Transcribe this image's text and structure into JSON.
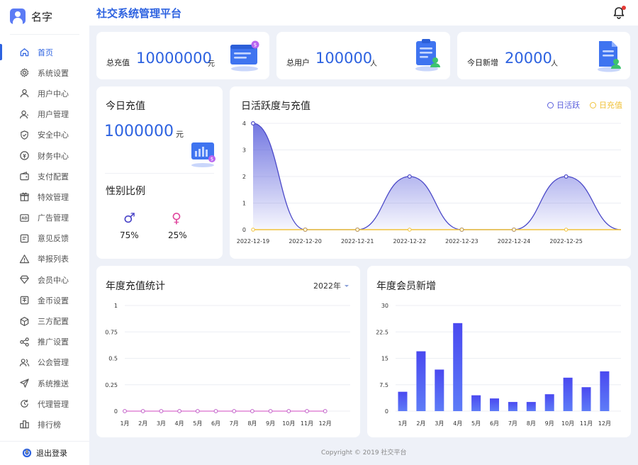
{
  "app": {
    "title": "社交系统管理平台",
    "user_name": "名字"
  },
  "sidebar": {
    "items": [
      {
        "label": "首页",
        "icon": "home-icon",
        "active": true
      },
      {
        "label": "系统设置",
        "icon": "gear-icon"
      },
      {
        "label": "用户中心",
        "icon": "user-icon"
      },
      {
        "label": "用户管理",
        "icon": "user-manage-icon"
      },
      {
        "label": "安全中心",
        "icon": "shield-icon"
      },
      {
        "label": "财务中心",
        "icon": "finance-icon"
      },
      {
        "label": "支付配置",
        "icon": "wallet-icon"
      },
      {
        "label": "特效管理",
        "icon": "gift-icon"
      },
      {
        "label": "广告管理",
        "icon": "ad-icon"
      },
      {
        "label": "意见反馈",
        "icon": "feedback-icon"
      },
      {
        "label": "举报列表",
        "icon": "warning-icon"
      },
      {
        "label": "会员中心",
        "icon": "diamond-icon"
      },
      {
        "label": "金币设置",
        "icon": "coin-icon"
      },
      {
        "label": "三方配置",
        "icon": "cube-icon"
      },
      {
        "label": "推广设置",
        "icon": "share-icon"
      },
      {
        "label": "公会管理",
        "icon": "group-icon"
      },
      {
        "label": "系统推送",
        "icon": "send-icon"
      },
      {
        "label": "代理管理",
        "icon": "proxy-icon"
      },
      {
        "label": "排行榜",
        "icon": "ranking-icon"
      }
    ],
    "logout_label": "退出登录"
  },
  "stats": [
    {
      "label": "总充值",
      "value": "10000000",
      "unit": "元"
    },
    {
      "label": "总用户",
      "value": "100000",
      "unit": "人"
    },
    {
      "label": "今日新增",
      "value": "20000",
      "unit": "人"
    }
  ],
  "today": {
    "title": "今日充值",
    "value": "1000000",
    "unit": "元",
    "gender_title": "性别比例",
    "male_pct": "75%",
    "female_pct": "25%",
    "male_symbol": "♂",
    "female_symbol": "♀"
  },
  "year_select": "2022年",
  "footer": {
    "copyright": "Copyright © 2019 社交平台"
  },
  "colors": {
    "accent": "#2d62e0",
    "active_series": "#5a5fdc",
    "recharge_series": "#f0c239",
    "male": "#4a44c8",
    "female": "#e0479e"
  },
  "chart_data": [
    {
      "id": "daily",
      "type": "area",
      "title": "日活跃度与充值",
      "x": [
        "2022-12-19",
        "2022-12-20",
        "2022-12-21",
        "2022-12-22",
        "2022-12-23",
        "2022-12-24",
        "2022-12-25"
      ],
      "series": [
        {
          "name": "日活跃",
          "values": [
            4,
            0,
            0,
            2,
            0,
            0,
            2
          ]
        },
        {
          "name": "日充值",
          "values": [
            0,
            0,
            0,
            0,
            0,
            0,
            0
          ]
        }
      ],
      "yticks": [
        "0",
        "1",
        "2",
        "3",
        "4"
      ],
      "ylim": [
        0,
        4
      ],
      "legend": "top-right"
    },
    {
      "id": "annual_recharge",
      "type": "line",
      "title": "年度充值统计",
      "categories": [
        "1月",
        "2月",
        "3月",
        "4月",
        "5月",
        "6月",
        "7月",
        "8月",
        "9月",
        "10月",
        "11月",
        "12月"
      ],
      "values": [
        0,
        0,
        0,
        0,
        0,
        0,
        0,
        0,
        0,
        0,
        0,
        0
      ],
      "yticks": [
        "0",
        "0.25",
        "0.5",
        "0.75",
        "1"
      ],
      "ylim": [
        0,
        1
      ]
    },
    {
      "id": "annual_members",
      "type": "bar",
      "title": "年度会员新增",
      "categories": [
        "1月",
        "2月",
        "3月",
        "4月",
        "5月",
        "6月",
        "7月",
        "8月",
        "9月",
        "10月",
        "11月",
        "12月"
      ],
      "values": [
        5.5,
        17,
        11.8,
        25,
        4.5,
        3.6,
        2.6,
        2.6,
        4.8,
        9.5,
        6.8,
        11.3
      ],
      "yticks": [
        "0",
        "7.5",
        "15",
        "22.5",
        "30"
      ],
      "ylim": [
        0,
        30
      ]
    }
  ]
}
